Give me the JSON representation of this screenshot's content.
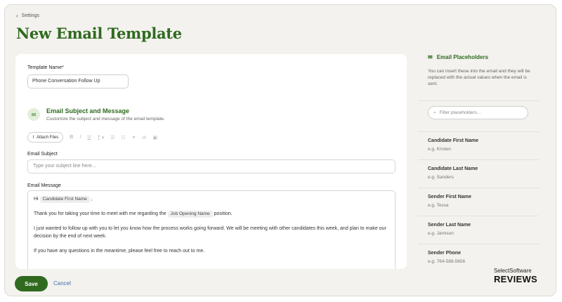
{
  "breadcrumb": {
    "label": "Settings"
  },
  "page_title": "New Email Template",
  "form": {
    "template_name_label": "Template Name*",
    "template_name_value": "Phone Conversation Follow Up",
    "section_title": "Email Subject and Message",
    "section_subtitle": "Customize the subject and message of the email template.",
    "attach_label": "Attach Files",
    "toolbar_icons": [
      "bold-icon",
      "italic-icon",
      "underline-icon",
      "text-color-icon",
      "bullet-list-icon",
      "numbered-list-icon",
      "link-icon",
      "unlink-icon",
      "image-icon"
    ],
    "subject_label": "Email Subject",
    "subject_placeholder": "Type your subject line here...",
    "message_label": "Email Message",
    "message": {
      "hi": "Hi",
      "chip_first_name": "Candidate First Name",
      "comma": ",",
      "line2_pre": "Thank you for taking your time to meet with me regarding the",
      "chip_job": "Job Opening Name",
      "line2_post": "position.",
      "line3": "I just wanted to follow up with you to let you know how the process works going forward. We will be meeting with other candidates this week, and plan to make our decision by the end of next week.",
      "line4": "If you have any questions in the meantime, please feel free to reach out to me."
    }
  },
  "sidebar": {
    "title": "Email Placeholders",
    "description": "You can insert these into the email and they will be replaced with the actual values when the email is sent.",
    "filter_placeholder": "Filter placeholders...",
    "items": [
      {
        "name": "Candidate First Name",
        "example": "e.g. Kristen"
      },
      {
        "name": "Candidate Last Name",
        "example": "e.g. Sanders"
      },
      {
        "name": "Sender First Name",
        "example": "e.g. Tessa"
      },
      {
        "name": "Sender Last Name",
        "example": "e.g. Jamison"
      },
      {
        "name": "Sender Phone",
        "example": "e.g. 764-588-5656"
      }
    ]
  },
  "footer": {
    "save_label": "Save",
    "cancel_label": "Cancel"
  },
  "watermark": {
    "line1": "SelectSoftware",
    "line2": "REVIEWS"
  },
  "colors": {
    "brand_green": "#2f6a1f",
    "link_blue": "#3f6fb0",
    "background": "#f3f2ee"
  }
}
